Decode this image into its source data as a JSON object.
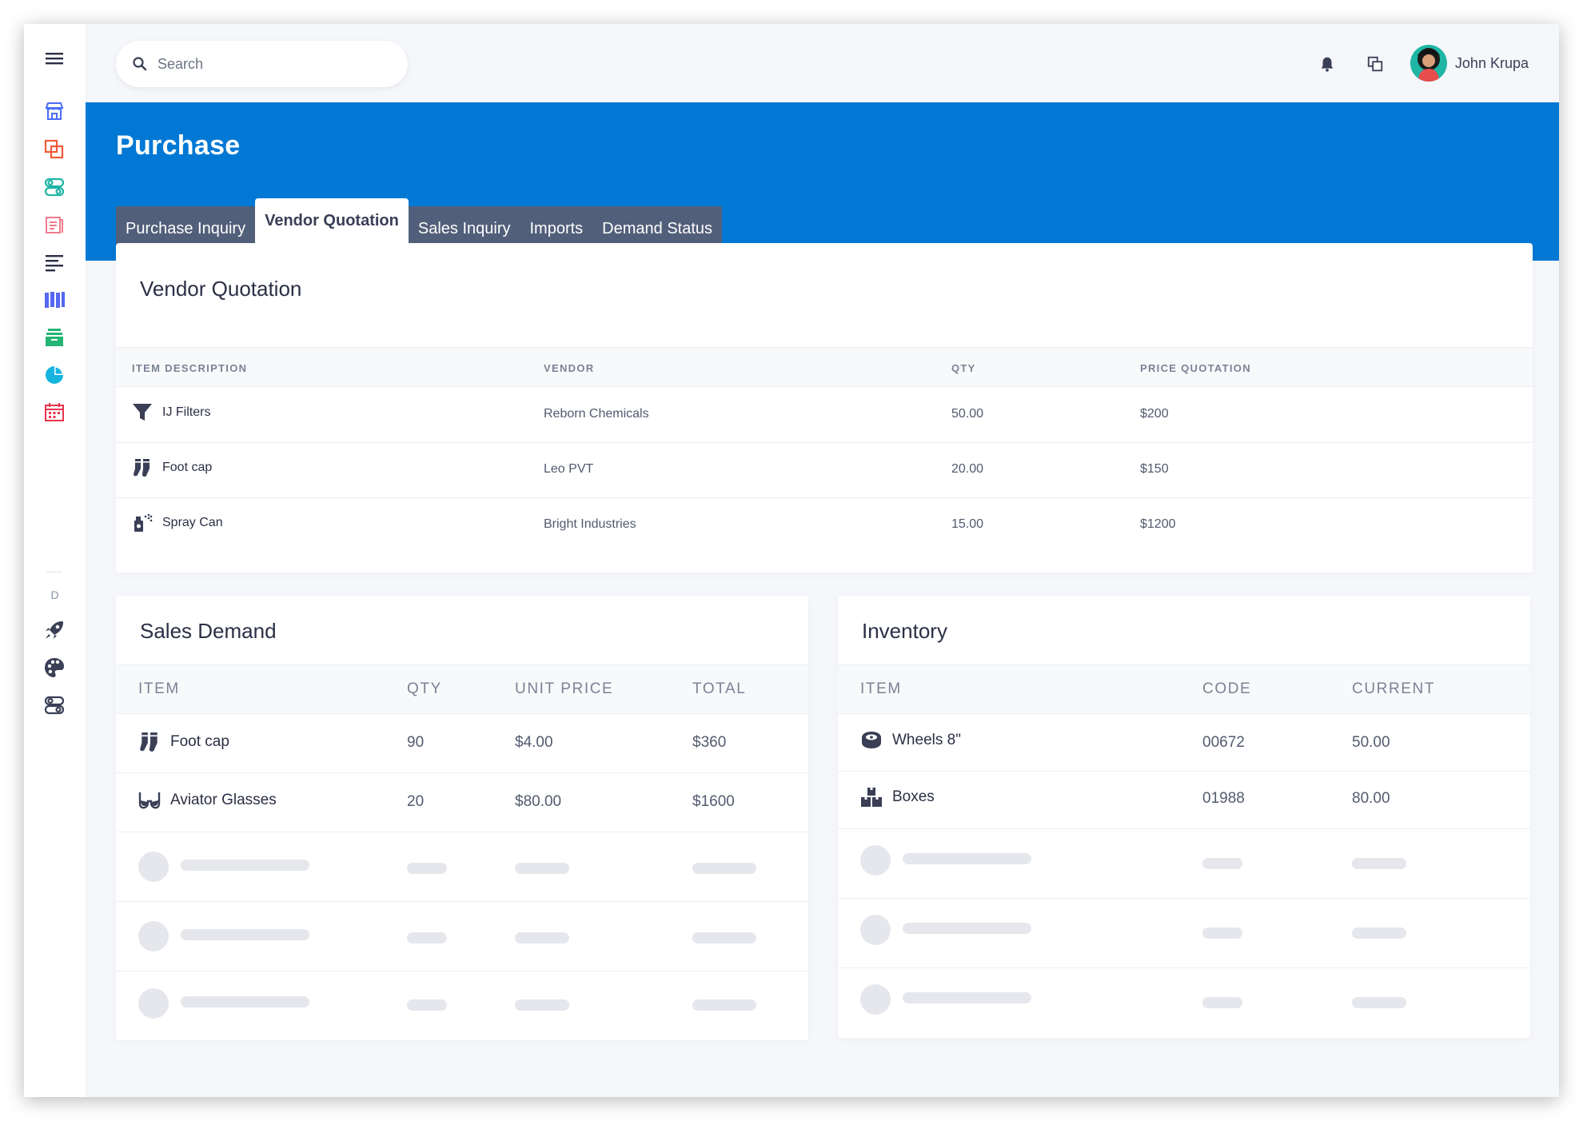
{
  "search": {
    "placeholder": "Search"
  },
  "header": {
    "user_name": "John Krupa"
  },
  "sidebar": {
    "section_label": "D"
  },
  "page": {
    "title": "Purchase",
    "tabs": [
      {
        "label": "Purchase Inquiry"
      },
      {
        "label": "Vendor Quotation",
        "active": true
      },
      {
        "label": "Sales Inquiry"
      },
      {
        "label": "Imports"
      },
      {
        "label": "Demand Status"
      }
    ]
  },
  "vendor_quotation": {
    "title": "Vendor Quotation",
    "columns": [
      "ITEM DESCRIPTION",
      "VENDOR",
      "QTY",
      "PRICE QUOTATION"
    ],
    "rows": [
      {
        "icon": "filter-icon",
        "item": "IJ Filters",
        "vendor": "Reborn Chemicals",
        "qty": "50.00",
        "price": "$200"
      },
      {
        "icon": "socks-icon",
        "item": "Foot cap",
        "vendor": "Leo PVT",
        "qty": "20.00",
        "price": "$150"
      },
      {
        "icon": "spray-can-icon",
        "item": "Spray Can",
        "vendor": "Bright Industries",
        "qty": "15.00",
        "price": "$1200"
      }
    ]
  },
  "sales_demand": {
    "title": "Sales Demand",
    "columns": [
      "ITEM",
      "QTY",
      "UNIT PRICE",
      "TOTAL"
    ],
    "rows": [
      {
        "icon": "socks-icon",
        "item": "Foot cap",
        "qty": "90",
        "unit_price": "$4.00",
        "total": "$360"
      },
      {
        "icon": "glasses-icon",
        "item": "Aviator Glasses",
        "qty": "20",
        "unit_price": "$80.00",
        "total": "$1600"
      }
    ]
  },
  "inventory": {
    "title": "Inventory",
    "columns": [
      "ITEM",
      "CODE",
      "CURRENT"
    ],
    "rows": [
      {
        "icon": "wheel-icon",
        "item": "Wheels 8\"",
        "code": "00672",
        "current": "50.00"
      },
      {
        "icon": "boxes-icon",
        "item": "Boxes",
        "code": "01988",
        "current": "80.00"
      }
    ]
  },
  "colors": {
    "primary_blue": "#0078d4",
    "tab_bg": "#525f7a"
  }
}
